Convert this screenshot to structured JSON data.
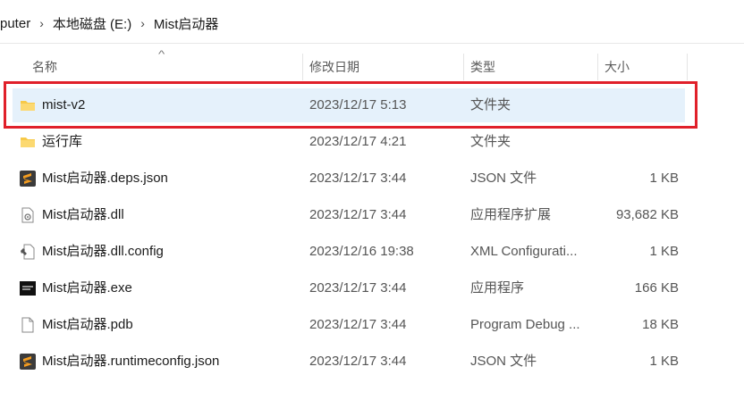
{
  "breadcrumb": [
    "puter",
    "本地磁盘 (E:)",
    "Mist启动器"
  ],
  "columns": {
    "name": "名称",
    "date": "修改日期",
    "type": "类型",
    "size": "大小"
  },
  "files": [
    {
      "name": "mist-v2",
      "date": "2023/12/17 5:13",
      "type": "文件夹",
      "size": "",
      "icon": "folder-icon",
      "selected": true
    },
    {
      "name": "运行库",
      "date": "2023/12/17 4:21",
      "type": "文件夹",
      "size": "",
      "icon": "folder-icon",
      "selected": false
    },
    {
      "name": "Mist启动器.deps.json",
      "date": "2023/12/17 3:44",
      "type": "JSON 文件",
      "size": "1 KB",
      "icon": "sublime-file-icon",
      "selected": false
    },
    {
      "name": "Mist启动器.dll",
      "date": "2023/12/17 3:44",
      "type": "应用程序扩展",
      "size": "93,682 KB",
      "icon": "dll-file-icon",
      "selected": false
    },
    {
      "name": "Mist启动器.dll.config",
      "date": "2023/12/16 19:38",
      "type": "XML Configurati...",
      "size": "1 KB",
      "icon": "config-file-icon",
      "selected": false
    },
    {
      "name": "Mist启动器.exe",
      "date": "2023/12/17 3:44",
      "type": "应用程序",
      "size": "166 KB",
      "icon": "exe-app-icon",
      "selected": false
    },
    {
      "name": "Mist启动器.pdb",
      "date": "2023/12/17 3:44",
      "type": "Program Debug ...",
      "size": "18 KB",
      "icon": "blank-file-icon",
      "selected": false
    },
    {
      "name": "Mist启动器.runtimeconfig.json",
      "date": "2023/12/17 3:44",
      "type": "JSON 文件",
      "size": "1 KB",
      "icon": "sublime-file-icon",
      "selected": false
    }
  ],
  "colors": {
    "selection": "#e5f1fb",
    "highlight_border": "#e0202a",
    "folder": "#f7c948"
  }
}
